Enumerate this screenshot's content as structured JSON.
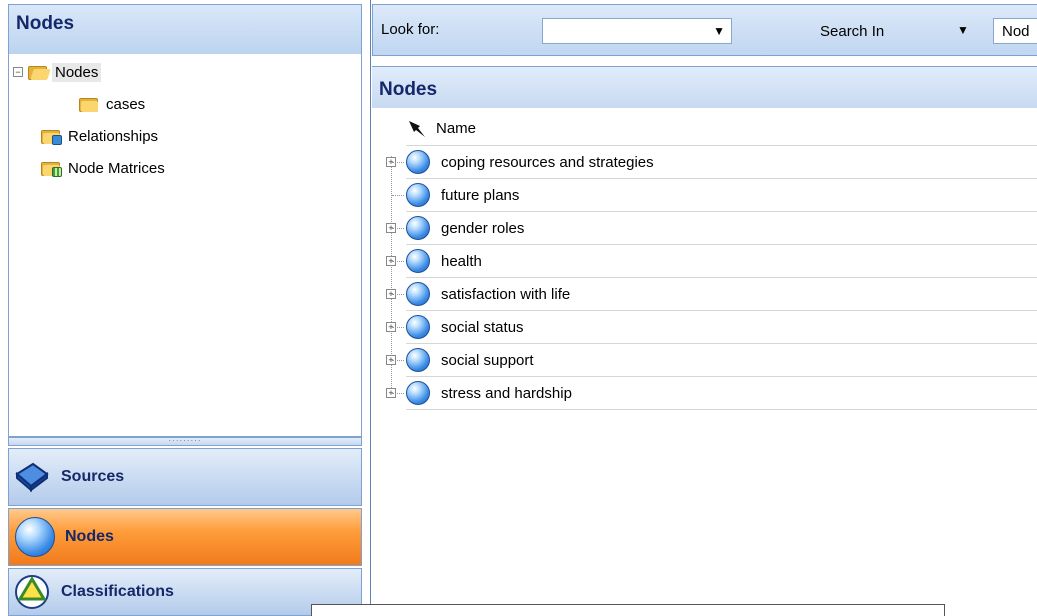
{
  "left_panel": {
    "title": "Nodes",
    "tree": [
      {
        "label": "Nodes",
        "selected": true,
        "expanded": true
      },
      {
        "label": "cases"
      },
      {
        "label": "Relationships"
      },
      {
        "label": "Node Matrices"
      }
    ],
    "splitter_grip": "·········"
  },
  "nav": {
    "sources": "Sources",
    "nodes": "Nodes",
    "classifications": "Classifications",
    "active": "Nodes",
    "active_color": "#f07b1c"
  },
  "find_bar": {
    "look_for_label": "Look for:",
    "look_for_value": "",
    "search_in_label": "Search In",
    "search_in_value": "Nod"
  },
  "list": {
    "title": "Nodes",
    "column_name": "Name",
    "rows": [
      {
        "label": "coping resources and strategies",
        "expandable": true
      },
      {
        "label": "future plans",
        "expandable": false
      },
      {
        "label": "gender roles",
        "expandable": true
      },
      {
        "label": "health",
        "expandable": true
      },
      {
        "label": "satisfaction with life",
        "expandable": true
      },
      {
        "label": "social status",
        "expandable": true
      },
      {
        "label": "social support",
        "expandable": true
      },
      {
        "label": "stress and hardship",
        "expandable": true
      }
    ]
  },
  "icons": {
    "tree_nodes": "open-folder-icon",
    "tree_cases": "folder-icon",
    "tree_relationships": "relationships-folder-icon",
    "tree_matrices": "matrix-folder-icon",
    "node": "node-sphere-icon",
    "pin": "pin-icon"
  }
}
